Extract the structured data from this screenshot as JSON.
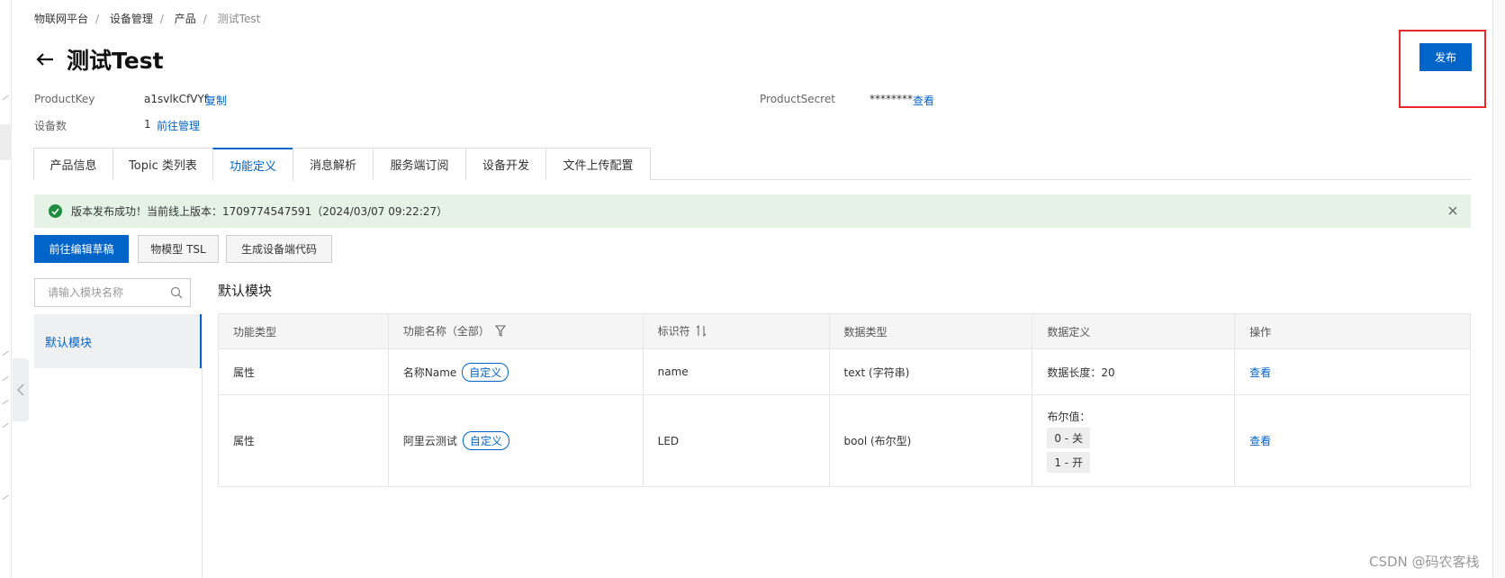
{
  "breadcrumb": [
    "物联网平台",
    "设备管理",
    "产品",
    "测试Test"
  ],
  "page_title": "测试Test",
  "meta": {
    "product_key_label": "ProductKey",
    "product_key_value": "a1svlkCfVYf",
    "copy_label": "复制",
    "device_count_label": "设备数",
    "device_count_value": "1",
    "manage_label": "前往管理",
    "product_secret_label": "ProductSecret",
    "product_secret_value": "********",
    "view_secret_label": "查看"
  },
  "publish_label": "发布",
  "tabs": [
    "产品信息",
    "Topic 类列表",
    "功能定义",
    "消息解析",
    "服务端订阅",
    "设备开发",
    "文件上传配置"
  ],
  "active_tab": "功能定义",
  "alert": {
    "text": "版本发布成功！当前线上版本：1709774547591（2024/03/07 09:22:27）"
  },
  "actions": {
    "edit_draft": "前往编辑草稿",
    "tsl": "物模型 TSL",
    "gen_code": "生成设备端代码"
  },
  "search": {
    "placeholder": "请输入模块名称"
  },
  "modules": [
    "默认模块"
  ],
  "module_title": "默认模块",
  "table": {
    "headers": [
      "功能类型",
      "功能名称（全部）",
      "标识符",
      "数据类型",
      "数据定义",
      "操作"
    ],
    "rows": [
      {
        "type": "属性",
        "name": "名称Name",
        "tag": "自定义",
        "identifier": "name",
        "data_type": "text (字符串)",
        "definition": "数据长度：20",
        "action": "查看"
      },
      {
        "type": "属性",
        "name": "阿里云测试",
        "tag": "自定义",
        "identifier": "LED",
        "data_type": "bool (布尔型)",
        "definition_label": "布尔值：",
        "enum_values": [
          "0 - 关",
          "1 - 开"
        ],
        "action": "查看"
      }
    ]
  },
  "watermark": "CSDN @码农客栈",
  "colors": {
    "accent": "#0064c8",
    "success_bg": "#e4f3e6",
    "highlight": "#e8292a"
  }
}
